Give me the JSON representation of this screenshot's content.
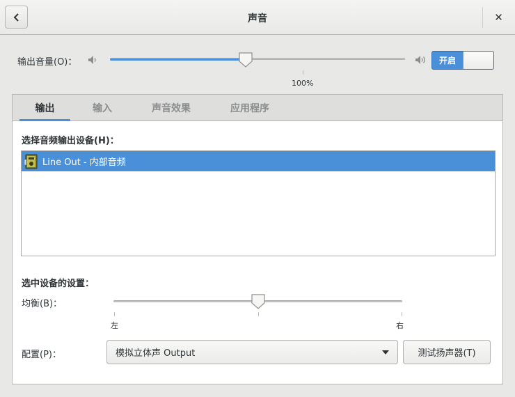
{
  "window": {
    "title": "声音"
  },
  "header": {
    "back_icon": "chevron-left-icon",
    "close_label": "✕"
  },
  "output_volume": {
    "label": "输出音量(O)：",
    "value_percent": 46,
    "mark_label": "100%",
    "switch_label": "开启",
    "switch_on": true
  },
  "tabs": [
    {
      "label": "输出",
      "active": true
    },
    {
      "label": "输入",
      "active": false
    },
    {
      "label": "声音效果",
      "active": false
    },
    {
      "label": "应用程序",
      "active": false
    }
  ],
  "output_tab": {
    "device_section_label": "选择音频输出设备(H)：",
    "devices": [
      {
        "name": "Line Out - 内部音频",
        "selected": true,
        "icon": "audio-card-icon"
      }
    ],
    "settings_section_label": "选中设备的设置：",
    "balance": {
      "label": "均衡(B)：",
      "value": 0.5,
      "left_label": "左",
      "right_label": "右"
    },
    "profile": {
      "label": "配置(P)：",
      "selected": "模拟立体声 Output"
    },
    "test_button_label": "测试扬声器(T)"
  },
  "colors": {
    "accent": "#4a90d9",
    "background": "#e8e8e7",
    "text": "#2e3436",
    "inactive_tab": "#8b8e8f"
  }
}
